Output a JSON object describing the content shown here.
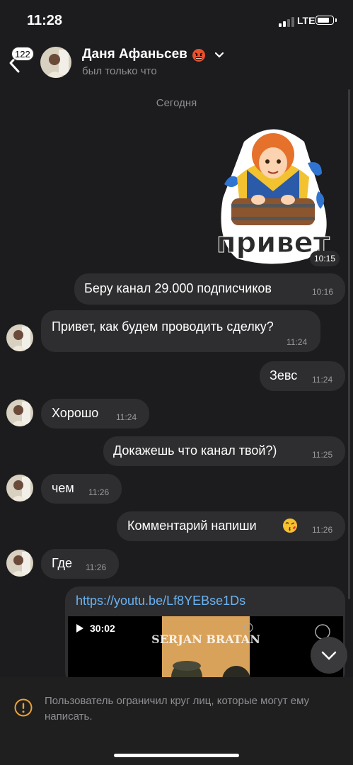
{
  "status_bar": {
    "time": "11:28",
    "network": "LTE",
    "battery_level": 0.85
  },
  "header": {
    "back_badge": "122",
    "contact_name": "Даня Афаньсев",
    "contact_status": "был только что",
    "name_emoji": "angry-face-emoji",
    "menu_icon": "chevron-down-icon"
  },
  "date_separator": "Сегодня",
  "sticker": {
    "caption": "привет",
    "time": "10:15"
  },
  "messages": [
    {
      "direction": "out",
      "text": "Беру канал 29.000 подписчиков",
      "time": "10:16"
    },
    {
      "direction": "in",
      "text": "Привет, как будем проводить сделку?",
      "time": "11:24"
    },
    {
      "direction": "out",
      "text": "Зевс",
      "time": "11:24"
    },
    {
      "direction": "in",
      "text": "Хорошо",
      "time": "11:24"
    },
    {
      "direction": "out",
      "text": "Докажешь что канал твой?)",
      "time": "11:25"
    },
    {
      "direction": "in",
      "text": "чем",
      "time": "11:26"
    },
    {
      "direction": "out",
      "text": "Комментарий напиши",
      "emoji": "kissing-face-emoji",
      "time": "11:26"
    },
    {
      "direction": "in",
      "text": "Где",
      "time": "11:26"
    }
  ],
  "link_message": {
    "url": "https://youtu.be/Lf8YEBse1Ds",
    "video_duration": "30:02",
    "poster_title": "SERJAN BRATAN"
  },
  "footer": {
    "notice": "Пользователь ограничил круг лиц, которые могут ему написать."
  },
  "colors": {
    "background": "#1c1c1e",
    "bubble": "#2e2e30",
    "link": "#6ab3f3",
    "warning": "#f0a030"
  }
}
